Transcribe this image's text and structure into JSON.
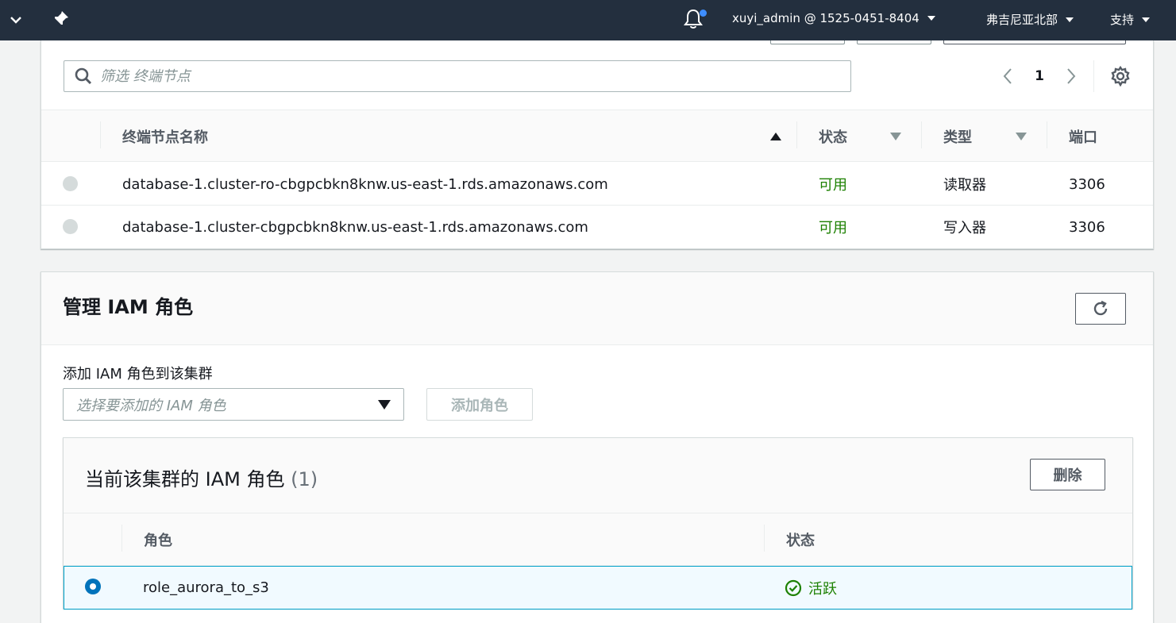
{
  "topnav": {
    "user": "xuyi_admin @ 1525-0451-8404",
    "region": "弗吉尼亚北部",
    "support": "支持",
    "icons": [
      "chevron-down-icon",
      "pin-icon",
      "bell-icon"
    ]
  },
  "endpoints": {
    "filter_placeholder": "筛选 终端节点",
    "page": "1",
    "columns": {
      "name": "终端节点名称",
      "status": "状态",
      "type": "类型",
      "port": "端口"
    },
    "rows": [
      {
        "name": "database-1.cluster-ro-cbgpcbkn8knw.us-east-1.rds.amazonaws.com",
        "status": "可用",
        "type": "读取器",
        "port": "3306"
      },
      {
        "name": "database-1.cluster-cbgpcbkn8knw.us-east-1.rds.amazonaws.com",
        "status": "可用",
        "type": "写入器",
        "port": "3306"
      }
    ]
  },
  "iam": {
    "title": "管理 IAM 角色",
    "add_label": "添加 IAM 角色到该集群",
    "select_placeholder": "选择要添加的 IAM 角色",
    "add_button": "添加角色",
    "current": {
      "title": "当前该集群的 IAM 角色",
      "count": "(1)",
      "delete_button": "删除",
      "columns": {
        "role": "角色",
        "status": "状态"
      },
      "rows": [
        {
          "role": "role_aurora_to_s3",
          "status": "活跃"
        }
      ]
    }
  },
  "colors": {
    "nav_bg": "#232f3e",
    "status_green": "#1d8102",
    "selected_blue": "#0073bb",
    "selected_row_bg": "#f1faff"
  }
}
